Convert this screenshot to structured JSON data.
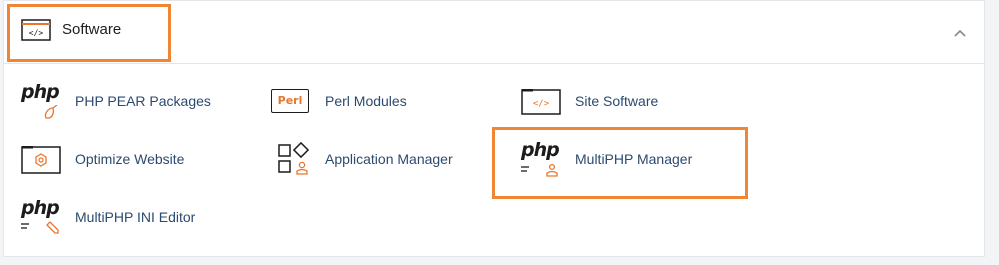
{
  "section": {
    "title": "Software",
    "collapse_icon": "chevron-up-icon"
  },
  "items": [
    {
      "label": "PHP PEAR Packages",
      "icon": "php-pear-icon",
      "icon_text": "php"
    },
    {
      "label": "Perl Modules",
      "icon": "perl-icon",
      "icon_text": "Perl"
    },
    {
      "label": "Site Software",
      "icon": "code-window-icon"
    },
    {
      "label": "Optimize Website",
      "icon": "optimize-website-icon"
    },
    {
      "label": "Application Manager",
      "icon": "application-manager-icon"
    },
    {
      "label": "MultiPHP Manager",
      "icon": "multiphp-manager-icon",
      "icon_text": "php"
    },
    {
      "label": "MultiPHP INI Editor",
      "icon": "multiphp-ini-editor-icon",
      "icon_text": "php"
    }
  ],
  "colors": {
    "accent": "#ee8636",
    "link": "#2b4a6f",
    "icon_orange": "#e8762d"
  }
}
